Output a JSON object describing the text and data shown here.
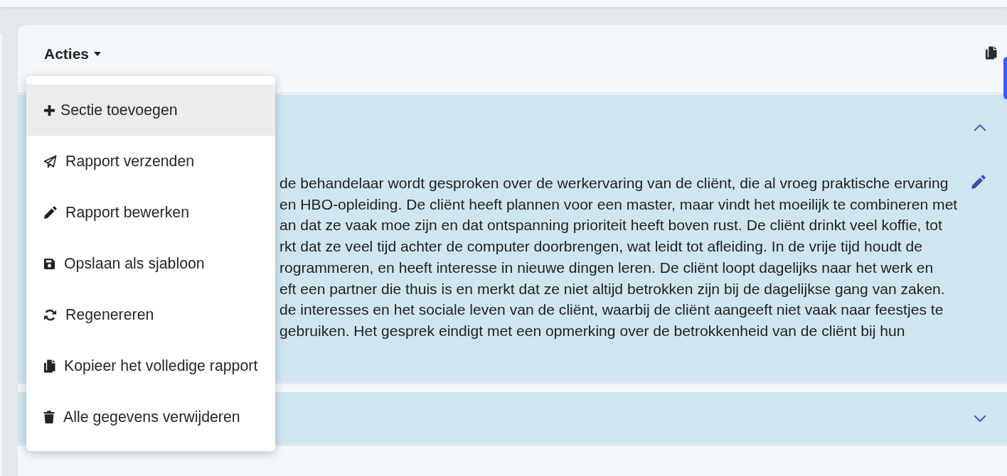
{
  "actions_menu": {
    "label": "Acties",
    "expanded": true,
    "items": [
      {
        "kind": "add",
        "label": "Sectie toevoegen",
        "selected": true
      },
      {
        "kind": "send",
        "label": "Rapport verzenden",
        "selected": false
      },
      {
        "kind": "edit",
        "label": "Rapport bewerken",
        "selected": false
      },
      {
        "kind": "save",
        "label": "Opslaan als sjabloon",
        "selected": false
      },
      {
        "kind": "regenerate",
        "label": "Regenereren",
        "selected": false
      },
      {
        "kind": "copy",
        "label": "Kopieer het volledige rapport",
        "selected": false
      },
      {
        "kind": "delete",
        "label": "Alle gegevens verwijderen",
        "selected": false
      }
    ]
  },
  "sections": [
    {
      "expanded": true,
      "text_lines": [
        "de behandelaar wordt gesproken over de werkervaring van de cliënt, die al vroeg praktische ervaring",
        "en HBO-opleiding. De cliënt heeft plannen voor een master, maar vindt het moeilijk te combineren met",
        "an dat ze vaak moe zijn en dat ontspanning prioriteit heeft boven rust. De cliënt drinkt veel koffie, tot",
        "rkt dat ze veel tijd achter de computer doorbrengen, wat leidt tot afleiding. In de vrije tijd houdt de",
        "rogrammeren, en heeft interesse in nieuwe dingen leren. De cliënt loopt dagelijks naar het werk en",
        "eft een partner die thuis is en merkt dat ze niet altijd betrokken zijn bij de dagelijkse gang van zaken.",
        "de interesses en het sociale leven van de cliënt, waarbij de cliënt aangeeft niet vaak naar feestjes te",
        "gebruiken. Het gesprek eindigt met een opmerking over de betrokkenheid van de cliënt bij hun"
      ]
    },
    {
      "expanded": false
    }
  ]
}
